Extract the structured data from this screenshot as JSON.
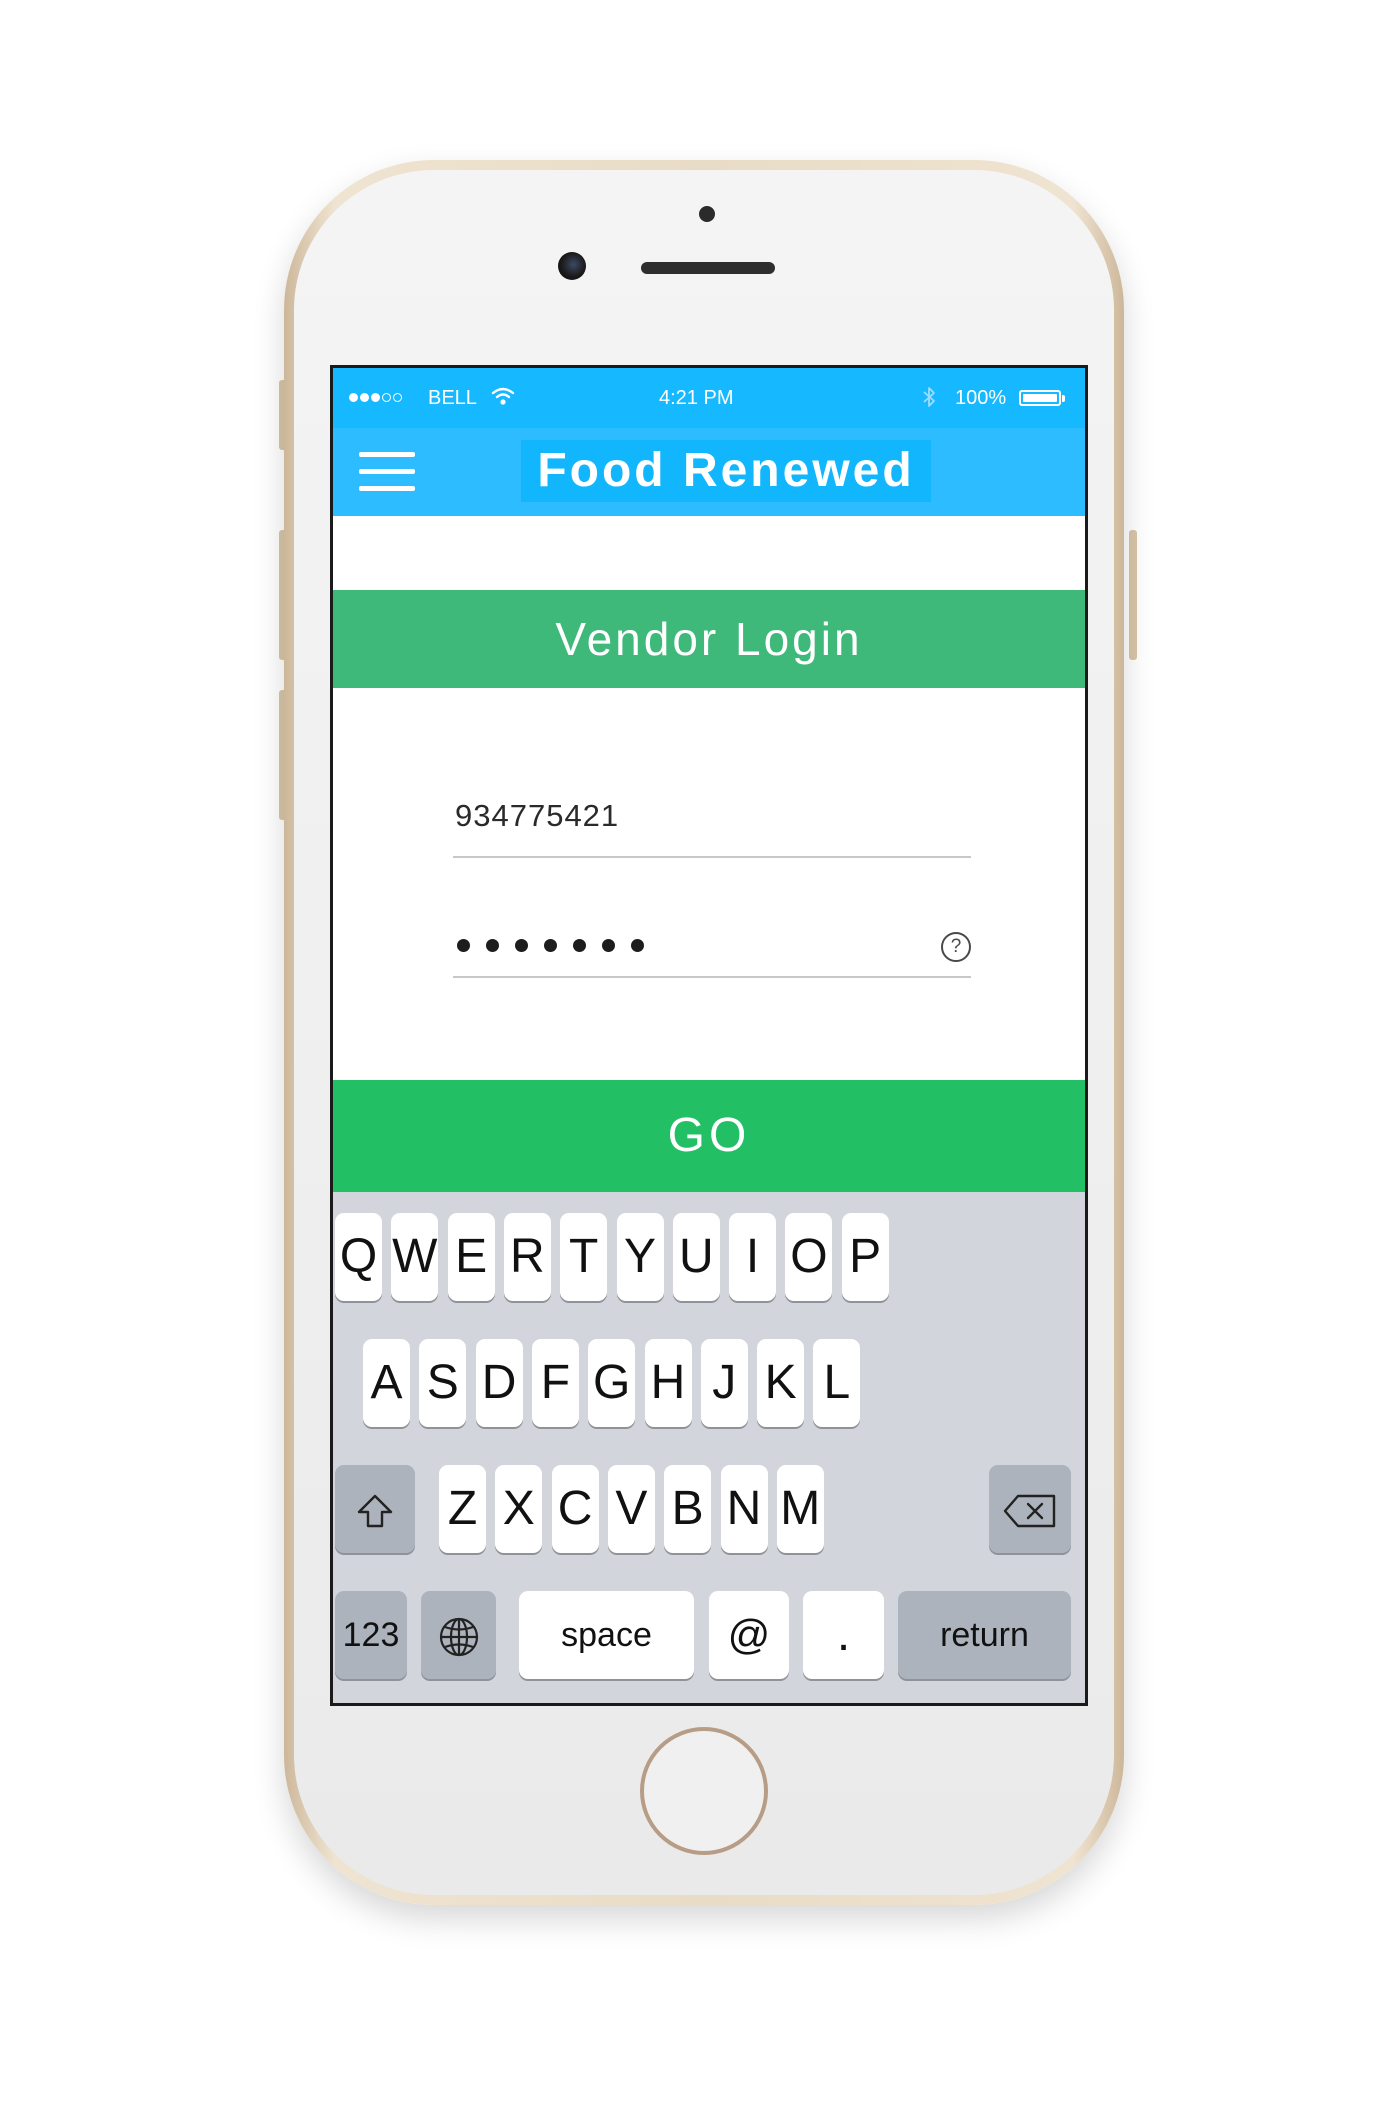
{
  "status_bar": {
    "carrier": "BELL",
    "time": "4:21 PM",
    "battery": "100%",
    "battery_level": 1.0,
    "signal_bars": 3,
    "signal_max": 5
  },
  "nav": {
    "title": "Food Renewed"
  },
  "login": {
    "heading": "Vendor Login",
    "username_value": "934775421",
    "password_length": 7,
    "help_glyph": "?",
    "go_label": "GO"
  },
  "keyboard": {
    "row1": [
      "Q",
      "W",
      "E",
      "R",
      "T",
      "Y",
      "U",
      "I",
      "O",
      "P"
    ],
    "row2": [
      "A",
      "S",
      "D",
      "F",
      "G",
      "H",
      "J",
      "K",
      "L"
    ],
    "row3": [
      "Z",
      "X",
      "C",
      "V",
      "B",
      "N",
      "M"
    ],
    "numbers_key": "123",
    "space_key": "space",
    "at_key": "@",
    "dot_key": ".",
    "return_key": "return"
  },
  "icons": {
    "menu": "hamburger-menu-icon",
    "wifi": "wifi-icon",
    "bluetooth": "bluetooth-icon",
    "shift": "shift-arrow-icon",
    "delete": "backspace-icon",
    "globe": "globe-icon",
    "help": "question-circle-icon"
  },
  "colors": {
    "status_bar": "#16b9ff",
    "nav_bar": "#2cbcff",
    "login_band": "#3fb97a",
    "go_button": "#23bf65",
    "keyboard": "#d2d5db"
  }
}
